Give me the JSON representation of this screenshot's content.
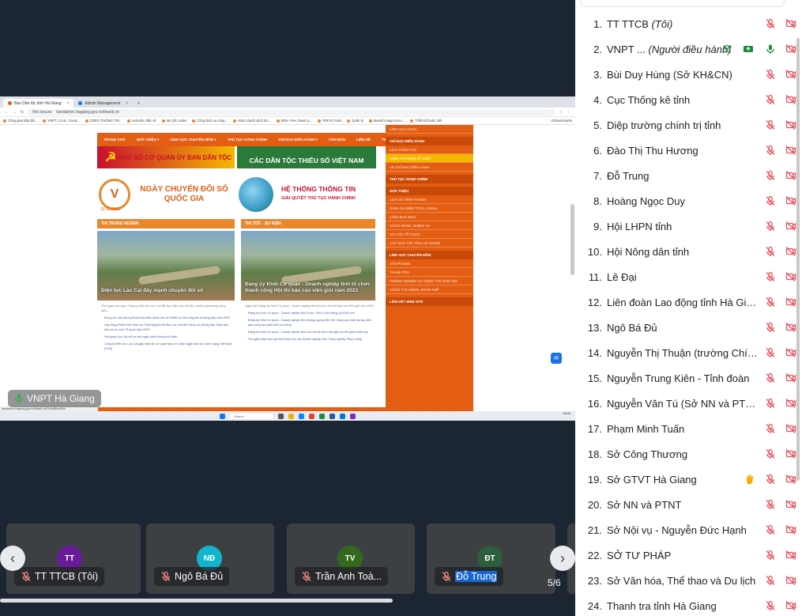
{
  "browser": {
    "tabs": [
      "Ban Dân tộc tỉnh Hà Giang",
      "Admin Management"
    ],
    "url_security": "Not secure",
    "url": "bandantoc.hagiang.gov.vn/tbweb.vn",
    "bookmarks": [
      "Cổng giao tiếp điệ...",
      "VNPT | CAS - Centr...",
      "CDRX ITHÔNG TIN...",
      "Hoá đơn điện tử",
      "My QR codes",
      "Cổng Dịch vụ công...",
      "HSKL Danh sách đơ...",
      "808+ Free Travel Ic...",
      "PDF24 Tools",
      "Quản lý",
      "Bewell Image Enco...",
      "Thiết kế thuộc tính"
    ],
    "all_bookmarks": "All Bookmarks",
    "status_url": "bandantoc.hagiang.gov.vn/tbweb.vn/ChienNhanVien",
    "taskbar_search": "Search",
    "clock_time": "08:54"
  },
  "website": {
    "nav": [
      "TRANG CHỦ",
      "GIỚI THIỆU ▾",
      "LĨNH VỰC CHUYÊN MÔN ▾",
      "THỦ TỤC HÀNH CHÍNH",
      "CHỈ ĐẠO ĐIỀU HÀNH ▾",
      "VĂN BẢN",
      "LIÊN HỆ",
      "TIN TỨC ▾",
      "ĐĂNG NHẬP"
    ],
    "banner_party": "ĐẢNG BỘ CƠ QUAN ỦY BAN DÂN TỘC",
    "banner_ethnic": "CÁC DÂN TỘC THIỂU SỐ VIỆT NAM",
    "banner_digital": "NGÀY CHUYỂN ĐỔI SỐ QUỐC GIA",
    "banner_digital_date": "10.10.2022",
    "banner_info_title": "HỆ THỐNG THÔNG TIN",
    "banner_info_sub": "GIẢI QUYẾT THỦ TỤC HÀNH CHÍNH",
    "col1_head": "TIN TRONG NGÀNH",
    "col2_head": "TIN TỨC - SỰ KIỆN",
    "col1_caption": "Điện lực Lào Cai đẩy mạnh chuyển đổi số",
    "col2_caption": "Đảng ủy Khối Cơ quan - Doanh nghiệp tỉnh tổ chức thành công Hội thi báo cáo viên giỏi năm 2023",
    "col1_summary": "Thời gian vừa qua, Công ty Điện lực Lào Cai đã thực hiện các chỉ tiêu, thành quả không cùng kiến...",
    "col2_summary": "Ngày 4/8, Đảng ủy Khối Cơ quan - Doanh nghiệp tỉnh tổ chức Hội thi báo cáo viên giỏi năm 2023",
    "col1_items": [
      "Đồng chí Văn phòng Đoàn Đại biểu Quốc hội và HĐND sơ kết công tác 6 tháng đầu năm 2023",
      "Xây dựng Phiên hiệu Đại học Thái Nguyên tại tỉnh Lào Cai đến trước và phòng trào Toàn dân bảo vệ an ninh Tổ quốc năm 2023",
      "Hải quan Lào Cai nỗ lực thu ngân sách trong khó khăn",
      "Công ty Điện lực Lào Cai gặp mặt các cơ quan báo chí nhân Ngày báo chí cách mạng Việt Nam (21/6)"
    ],
    "col2_items": [
      "Đảng ủy Khối Cơ quan - Doanh nghiệp tỉnh ủi thư, Phó bí thư Đảng ủy Khối mới",
      "Đảng ủy Khối Cơ quan - Doanh nghiệp tỉnh không ngừng đổi mới, nâng cao chất lượng, hiệu quả công tác phát triển tư tưởng",
      "Đảng ủy Khối Cơ quan - Doanh nghiệp tỉnh Lào Cai tổ chức hội nghị sơ kết giữa nhiệm kỳ",
      "Tìm giải pháp tháo gỡ khó khăn cho các Doanh nghiệp Khu Công nghiệp Tằng Loỏng"
    ],
    "sidebar": [
      {
        "label": "LĨNH VỰC KHÁC",
        "head": false,
        "hl": false
      },
      {
        "label": "CHỈ ĐẠO ĐIỀU HÀNH",
        "head": true,
        "hl": false
      },
      {
        "label": "LỊCH CÔNG TÁC",
        "head": false,
        "hl": false
      },
      {
        "label": "KHEN THƯỞNG KỶ LUẬT",
        "head": false,
        "hl": true
      },
      {
        "label": "VB CHỈ ĐẠO ĐIỀU HÀNH",
        "head": false,
        "hl": false
      },
      {
        "label": "THỦ TỤC HÀNH CHÍNH",
        "head": true,
        "hl": false
      },
      {
        "label": "GIỚI THIỆU",
        "head": true,
        "hl": false
      },
      {
        "label": "LỊCH SỬ HÌNH THÀNH",
        "head": false,
        "hl": false
      },
      {
        "label": "DANH BẠ ĐIỆN THOẠI, EMAIL",
        "head": false,
        "hl": false
      },
      {
        "label": "LÃNH ĐẠO BAN",
        "head": false,
        "hl": false
      },
      {
        "label": "CHỨC NĂNG, NHIỆM VỤ",
        "head": false,
        "hl": false
      },
      {
        "label": "CƠ CẤU TỔ CHỨC",
        "head": false,
        "hl": false
      },
      {
        "label": "CÁC DÂN TỘC TỈNH HÀ GIANG",
        "head": false,
        "hl": false
      },
      {
        "label": "LĨNH VỰC CHUYÊN MÔN",
        "head": true,
        "hl": false
      },
      {
        "label": "VĂN PHÒNG",
        "head": false,
        "hl": false
      },
      {
        "label": "THANH TRA",
        "head": false,
        "hl": false
      },
      {
        "label": "PHÒNG NGHIỆP VỤ CÔNG TÁC DÂN TỘC",
        "head": false,
        "hl": false
      },
      {
        "label": "CÔNG TÁC ĐẢNG, ĐOÀN THỂ",
        "head": false,
        "hl": false
      },
      {
        "label": "LIÊN KẾT WEB SITE",
        "head": true,
        "hl": false
      }
    ],
    "bottom_strip": "LĨNH VỰC KHÁC"
  },
  "presenter": "VNPT Hà Giang",
  "filmstrip": {
    "tiles": [
      {
        "initials": "TT",
        "name": "TT TTCB (Tôi)",
        "color": "#6a1b9a"
      },
      {
        "initials": "NĐ",
        "name": "Ngô Bá Đủ",
        "color": "#12b5cb"
      },
      {
        "initials": "TV",
        "name": "Trần Anh Toà...",
        "color": "#33691e"
      },
      {
        "initials": "ĐT",
        "name": "Đỗ Trung",
        "color": "#2e5e3e"
      }
    ],
    "page": "5/6",
    "prev": "‹",
    "next": "›"
  },
  "participants": [
    {
      "num": "1.",
      "name": "TT TTCB",
      "suffix": "(Tôi)"
    },
    {
      "num": "2.",
      "name": "VNPT ...",
      "suffix": "(Người điều hành)"
    },
    {
      "num": "3.",
      "name": "Bùi Duy Hùng (Sở KH&CN)"
    },
    {
      "num": "4.",
      "name": "Cục Thống kê tỉnh"
    },
    {
      "num": "5.",
      "name": "Diệp trường chính trị tỉnh"
    },
    {
      "num": "6.",
      "name": "Đào Thị Thu Hương"
    },
    {
      "num": "7.",
      "name": "Đỗ Trung"
    },
    {
      "num": "8.",
      "name": "Hoàng Ngọc Duy"
    },
    {
      "num": "9.",
      "name": "Hội LHPN tỉnh"
    },
    {
      "num": "10.",
      "name": "Hội Nông dân tỉnh"
    },
    {
      "num": "11.",
      "name": "Lê Đại"
    },
    {
      "num": "12.",
      "name": "Liên đoàn Lao động tỉnh Hà Giang"
    },
    {
      "num": "13.",
      "name": "Ngô Bá Đủ"
    },
    {
      "num": "14.",
      "name": "Nguyễn Thị Thuận (trường Chính t..."
    },
    {
      "num": "15.",
      "name": "Nguyễn Trung Kiên - Tỉnh đoàn"
    },
    {
      "num": "16.",
      "name": "Nguyễn Văn Tú (Sở NN và PTNT)"
    },
    {
      "num": "17.",
      "name": "Phạm Minh Tuấn"
    },
    {
      "num": "18.",
      "name": "Sở Công Thương"
    },
    {
      "num": "19.",
      "name": "Sở GTVT Hà Giang"
    },
    {
      "num": "20.",
      "name": "Sở NN và PTNT"
    },
    {
      "num": "21.",
      "name": "Sở Nội vụ - Nguyễn Đức Hạnh"
    },
    {
      "num": "22.",
      "name": "SỞ TƯ PHÁP"
    },
    {
      "num": "23.",
      "name": "Sở Văn hóa, Thể thao và Du lịch"
    },
    {
      "num": "24.",
      "name": "Thanh tra tỉnh Hà Giang"
    }
  ],
  "colors": {
    "muted_red": "#e8505b",
    "host_green": "#1e8e3e",
    "raise_hand": "#f9ab00",
    "site_orange": "#e35d12"
  }
}
